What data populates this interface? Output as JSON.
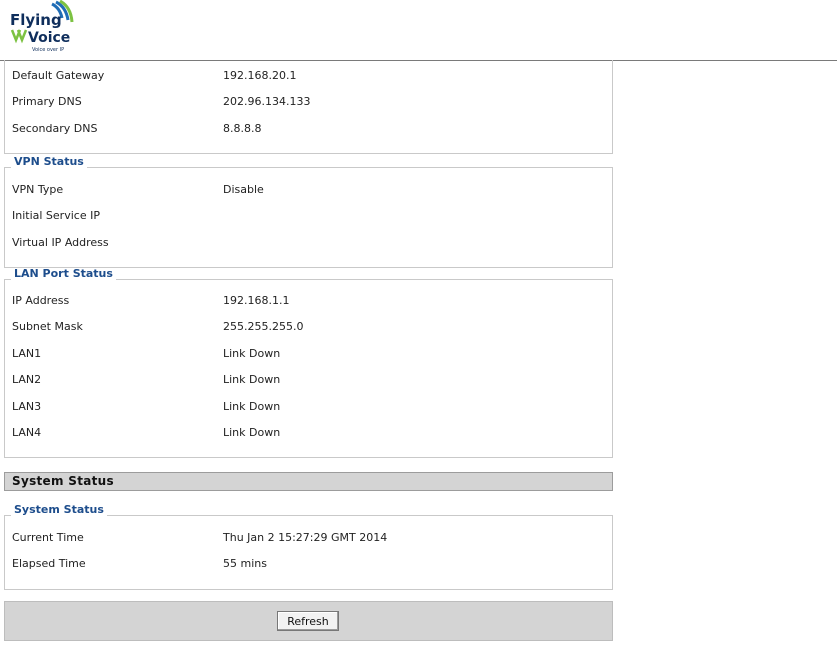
{
  "logo": {
    "line1": "Flying",
    "line2": "Voice",
    "tagline": "Voice over IP",
    "colors": {
      "green": "#7cc242",
      "blue": "#1f6db6",
      "dark": "#0f2e5c"
    }
  },
  "wan_tail": {
    "rows": [
      {
        "label": "Default Gateway",
        "value": "192.168.20.1"
      },
      {
        "label": "Primary DNS",
        "value": "202.96.134.133"
      },
      {
        "label": "Secondary DNS",
        "value": "8.8.8.8"
      }
    ]
  },
  "vpn": {
    "legend": "VPN Status",
    "rows": [
      {
        "label": "VPN Type",
        "value": "Disable"
      },
      {
        "label": "Initial Service IP",
        "value": ""
      },
      {
        "label": "Virtual IP Address",
        "value": ""
      }
    ]
  },
  "lan": {
    "legend": "LAN Port Status",
    "rows": [
      {
        "label": "IP Address",
        "value": "192.168.1.1"
      },
      {
        "label": "Subnet Mask",
        "value": "255.255.255.0"
      },
      {
        "label": "LAN1",
        "value": "Link Down"
      },
      {
        "label": "LAN2",
        "value": "Link Down"
      },
      {
        "label": "LAN3",
        "value": "Link Down"
      },
      {
        "label": "LAN4",
        "value": "Link Down"
      }
    ]
  },
  "system": {
    "section_title": "System Status",
    "legend": "System Status",
    "rows": [
      {
        "label": "Current Time",
        "value": "Thu Jan 2 15:27:29 GMT 2014"
      },
      {
        "label": "Elapsed Time",
        "value": "55 mins"
      }
    ]
  },
  "footer": {
    "refresh_label": "Refresh"
  }
}
